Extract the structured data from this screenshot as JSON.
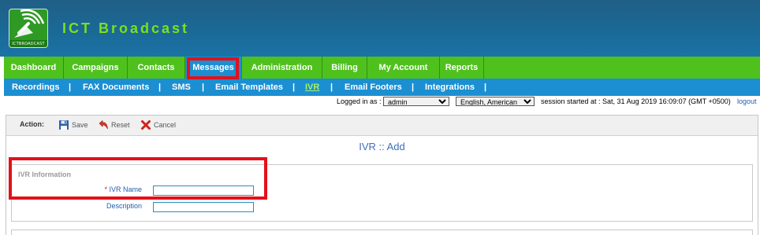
{
  "app": {
    "title": "ICT Broadcast",
    "logo_text": "ICTBROADCAST"
  },
  "main_nav": {
    "tabs": [
      {
        "label": "Dashboard"
      },
      {
        "label": "Campaigns"
      },
      {
        "label": "Contacts"
      },
      {
        "label": "Messages",
        "active": true
      },
      {
        "label": "Administration"
      },
      {
        "label": "Billing"
      },
      {
        "label": "My Account"
      },
      {
        "label": "Reports"
      }
    ]
  },
  "sub_nav": {
    "items": [
      {
        "label": "Recordings"
      },
      {
        "label": "FAX Documents"
      },
      {
        "label": "SMS"
      },
      {
        "label": "Email Templates"
      },
      {
        "label": "IVR",
        "active": true
      },
      {
        "label": "Email Footers"
      },
      {
        "label": "Integrations"
      }
    ],
    "separator": "|"
  },
  "status": {
    "logged_in_label": "Logged in as :",
    "user": "admin",
    "language": "English, American",
    "session_text": "session started at : Sat, 31 Aug 2019 16:09:07 (GMT +0500)",
    "logout": "logout"
  },
  "toolbar": {
    "action_label": "Action:",
    "save": "Save",
    "reset": "Reset",
    "cancel": "Cancel"
  },
  "page": {
    "title": "IVR :: Add"
  },
  "form": {
    "section_title": "IVR Information",
    "required_mark": "*",
    "fields": [
      {
        "label": "IVR Name",
        "value": ""
      },
      {
        "label": "Description",
        "value": ""
      }
    ]
  },
  "colors": {
    "header": "#1a6a98",
    "main_nav": "#4fc11d",
    "sub_nav": "#1b8fd2",
    "title_green": "#7be01d",
    "highlight": "#e3111b"
  }
}
